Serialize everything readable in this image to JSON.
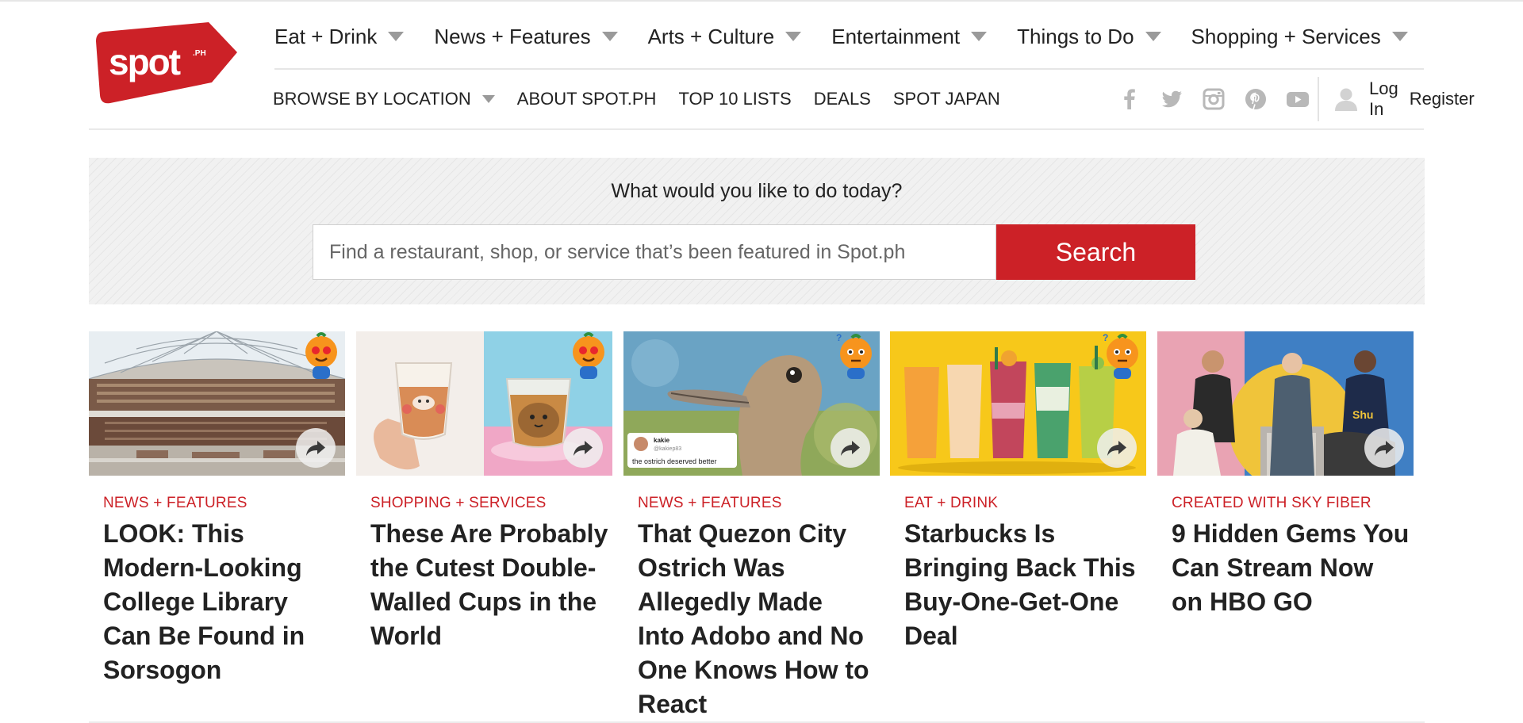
{
  "brand": {
    "logo_text": "spot",
    "logo_suffix": ".PH",
    "accent": "#cc2127"
  },
  "main_nav": [
    {
      "label": "Eat + Drink"
    },
    {
      "label": "News + Features"
    },
    {
      "label": "Arts + Culture"
    },
    {
      "label": "Entertainment"
    },
    {
      "label": "Things to Do"
    },
    {
      "label": "Shopping + Services"
    }
  ],
  "sub_nav": {
    "browse": "BROWSE BY LOCATION",
    "about": "ABOUT SPOT.PH",
    "top10": "TOP 10 LISTS",
    "deals": "DEALS",
    "japan": "SPOT JAPAN"
  },
  "social": [
    "facebook-icon",
    "twitter-icon",
    "instagram-icon",
    "pinterest-icon",
    "youtube-icon"
  ],
  "account": {
    "login": "Log In",
    "register": "Register"
  },
  "search": {
    "prompt": "What would you like to do today?",
    "placeholder": "Find a restaurant, shop, or service that’s been featured in Spot.ph",
    "button": "Search"
  },
  "cards": [
    {
      "category": "NEWS + FEATURES",
      "title": "LOOK: This Modern-Looking College Library Can Be Found in Sorsogon"
    },
    {
      "category": "SHOPPING + SERVICES",
      "title": "These Are Probably the Cutest Double-Walled Cups in the World"
    },
    {
      "category": "NEWS + FEATURES",
      "title": "That Quezon City Ostrich Was Allegedly Made Into Adobo and No One Knows How to React",
      "tweet_name": "kakie",
      "tweet_handle": "@kakiep83",
      "tweet_text": "the ostrich deserved better"
    },
    {
      "category": "EAT + DRINK",
      "title": "Starbucks Is Bringing Back This Buy-One-Get-One Deal"
    },
    {
      "category": "CREATED WITH SKY FIBER",
      "title": "9 Hidden Gems You Can Stream Now on HBO GO"
    }
  ]
}
